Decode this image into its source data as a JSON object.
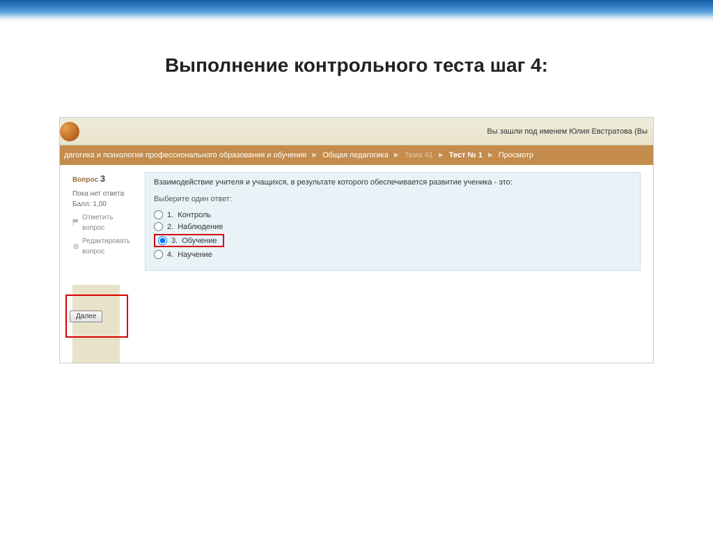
{
  "slide": {
    "title": "Выполнение контрольного теста шаг 4:"
  },
  "userbar": {
    "text": "Вы зашли под именем Юлия Евстратова (Вы"
  },
  "breadcrumb": {
    "items": [
      "дагогика и психология профессионального образования и обучения",
      "Общая педагогика",
      "Тема 41",
      "Тест № 1",
      "Просмотр"
    ],
    "sep": "►"
  },
  "question": {
    "label": "Вопрос",
    "number": "3",
    "status": "Пока нет ответа",
    "score_label": "Балл: 1,00",
    "flag_label": "Отметить вопрос",
    "edit_label": "Редактировать вопрос",
    "text": "Взаимодействие учителя и учащихся, в результате которого обеспечивается развитие ученика -  это:",
    "instruction": "Выберите один ответ:",
    "answers": [
      {
        "num": "1.",
        "text": "Контроль",
        "checked": false
      },
      {
        "num": "2.",
        "text": "Наблюдение",
        "checked": false
      },
      {
        "num": "3.",
        "text": "Обучение",
        "checked": true
      },
      {
        "num": "4.",
        "text": "Научение",
        "checked": false
      }
    ]
  },
  "controls": {
    "next": "Далее"
  }
}
